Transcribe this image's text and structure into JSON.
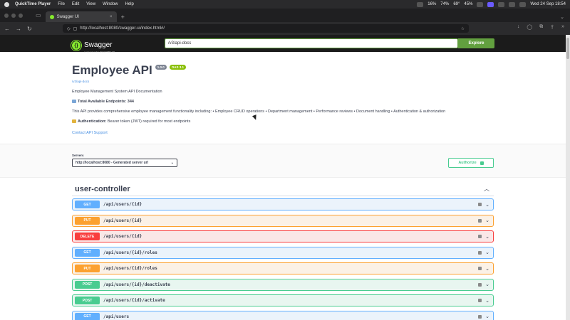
{
  "menubar": {
    "app_name": "QuickTime Player",
    "items": [
      "File",
      "Edit",
      "View",
      "Window",
      "Help"
    ],
    "clock": "Wed 24 Sep  18:54",
    "stats": [
      "16%",
      "74%",
      "69°",
      "45%"
    ]
  },
  "browser": {
    "tab_title": "Swagger UI",
    "url": "http://localhost:8080/swagger-ui/index.html#/"
  },
  "swagger": {
    "logo_text": "Swagger",
    "logo_sub": "supported by SMARTBEAR",
    "search_value": "/v3/api-docs",
    "explore_label": "Explore"
  },
  "info": {
    "title": "Employee API",
    "version": "1.0.0",
    "oas": "OAS 3.1",
    "spec_link": "/v3/api-docs",
    "description": "Employee Management System API Documentation",
    "endpoints_label": "Total Available Endpoints:",
    "endpoints_value": "344",
    "features": "This API provides comprehensive employee management functionality including: • Employee CRUD operations • Department management • Performance reviews • Document handling • Authentication & authorization",
    "auth_label": "Authentication:",
    "auth_text": "Bearer token (JWT) required for most endpoints",
    "contact": "Contact API Support"
  },
  "servers": {
    "label": "Servers",
    "selected": "http://localhost:8080 - Generated server url",
    "authorize_label": "Authorize"
  },
  "tag": {
    "name": "user-controller"
  },
  "operations": [
    {
      "method": "GET",
      "path": "/api/users/{id}"
    },
    {
      "method": "PUT",
      "path": "/api/users/{id}"
    },
    {
      "method": "DELETE",
      "path": "/api/users/{id}"
    },
    {
      "method": "GET",
      "path": "/api/users/{id}/roles"
    },
    {
      "method": "PUT",
      "path": "/api/users/{id}/roles"
    },
    {
      "method": "POST",
      "path": "/api/users/{id}/deactivate"
    },
    {
      "method": "POST",
      "path": "/api/users/{id}/activate"
    },
    {
      "method": "GET",
      "path": "/api/users"
    }
  ]
}
